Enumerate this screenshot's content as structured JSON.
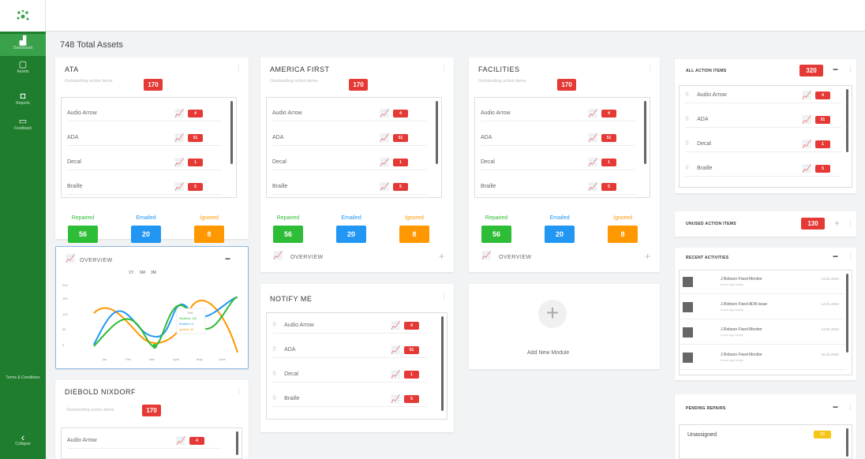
{
  "sidebar": {
    "items": [
      {
        "label": "Dashboard",
        "icon": "chart-icon"
      },
      {
        "label": "Assets",
        "icon": "asset-icon"
      },
      {
        "label": "Reports",
        "icon": "reports-icon"
      },
      {
        "label": "Feedback",
        "icon": "feedback-icon"
      }
    ],
    "terms": "Terms & Conditions",
    "collapse": "Collapse"
  },
  "header": {
    "total": "748 Total Assets"
  },
  "rowlabels": [
    "Audio Arrow",
    "ADA",
    "Decal",
    "Braille"
  ],
  "badges": [
    "4",
    "51",
    "1",
    "5"
  ],
  "modules": [
    {
      "title": "ATA",
      "subtitle": "Outstanding action items",
      "count": "170"
    },
    {
      "title": "AMERICA FIRST",
      "subtitle": "Outstanding action items",
      "count": "170"
    },
    {
      "title": "FACILITIES",
      "subtitle": "Outstanding action items",
      "count": "170"
    }
  ],
  "stats": {
    "repaired_label": "Repaired",
    "emailed_label": "Emailed",
    "ignored_label": "Ignored",
    "repaired": "56",
    "emailed": "20",
    "ignored": "8"
  },
  "overview": {
    "label": "OVERVIEW",
    "ranges": [
      "1Y",
      "6M",
      "3M"
    ],
    "tooltip": [
      "Total",
      "Repaired: 140",
      "Emailed: 74",
      "Ignored: 48"
    ],
    "xlabels": [
      "Jan",
      "Feb",
      "Mar",
      "April",
      "May",
      "June"
    ],
    "ylabels": [
      "200",
      "150",
      "100",
      "50",
      "0"
    ]
  },
  "notify": {
    "title": "NOTIFY ME"
  },
  "addmodule": {
    "label": "Add New Module"
  },
  "diebold": {
    "title": "DIEBOLD NIXDORF",
    "subtitle": "Outstanding action items",
    "count": "170",
    "row": "Audio Arrow"
  },
  "right": {
    "all": {
      "title": "ALL ACTION ITEMS",
      "count": "320"
    },
    "unused": {
      "title": "UNUSED ACTION ITEMS",
      "count": "130"
    },
    "recent": {
      "title": "RECENT ACTIVITIES",
      "items": [
        {
          "who": "J.Robson Fixed Monitor",
          "sub": "hours ago today",
          "date": "13.01.2022"
        },
        {
          "who": "J.Robson Fixed ADA Issue",
          "sub": "hours ago today",
          "date": "14.01.2022"
        },
        {
          "who": "J.Robson Fixed Monitor",
          "sub": "hours ago today",
          "date": "14.01.2022"
        },
        {
          "who": "J.Robson Fixed Monitor",
          "sub": "hours ago today",
          "date": "15.01.2022"
        }
      ]
    },
    "pending": {
      "title": "PENDING REPAIRS",
      "unassigned": "Unassigned",
      "unassigned_count": "20"
    }
  },
  "colors": {
    "green": "#2ebd36",
    "blue": "#2196f3",
    "orange": "#ff9800",
    "red": "#e53935"
  }
}
